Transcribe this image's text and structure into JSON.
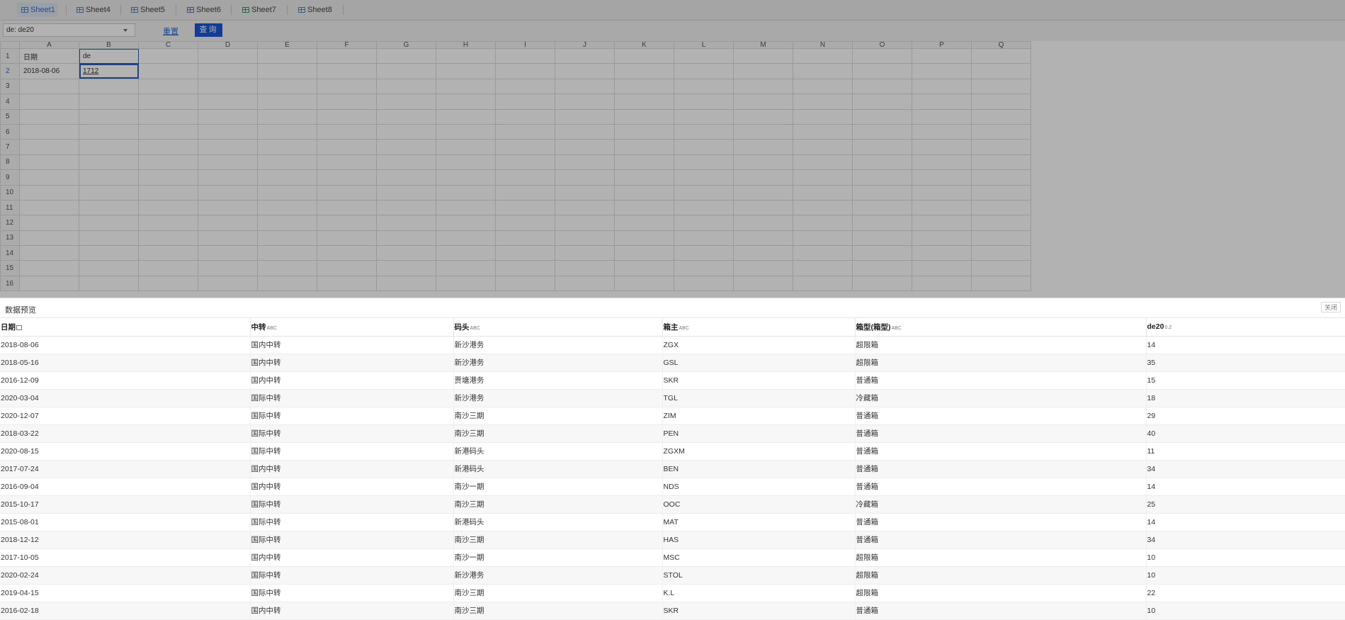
{
  "tabs": [
    {
      "label": "Sheet1",
      "active": true
    },
    {
      "label": "Sheet4",
      "active": false
    },
    {
      "label": "Sheet5",
      "active": false
    },
    {
      "label": "Sheet6",
      "active": false
    },
    {
      "label": "Sheet7",
      "active": false
    },
    {
      "label": "Sheet8",
      "active": false
    }
  ],
  "toolbar": {
    "param_value": "de: de20",
    "reset_label": "重置",
    "query_label": "查询"
  },
  "sheet": {
    "columns": [
      "A",
      "B",
      "C",
      "D",
      "E",
      "F",
      "G",
      "H",
      "I",
      "J",
      "K",
      "L",
      "M",
      "N",
      "O",
      "P",
      "Q"
    ],
    "row_numbers": [
      "1",
      "2",
      "3",
      "4",
      "5",
      "6",
      "7",
      "8",
      "9",
      "10",
      "11",
      "12",
      "13",
      "14",
      "15",
      "16"
    ],
    "selected_column": "B",
    "active_row": "2",
    "cells": {
      "A1": "日期",
      "B1": "de",
      "A2": "2018-08-06",
      "B2": "1712"
    }
  },
  "preview": {
    "title": "数据预览",
    "close_label": "关闭",
    "columns": [
      {
        "label": "日期",
        "type": "date-icon"
      },
      {
        "label": "中转",
        "type": "ABC"
      },
      {
        "label": "码头",
        "type": "ABC"
      },
      {
        "label": "箱主",
        "type": "ABC"
      },
      {
        "label": "箱型(箱型)",
        "type": "ABC"
      },
      {
        "label": "de20",
        "type": "0.2"
      }
    ],
    "rows": [
      [
        "2018-08-06",
        "国内中转",
        "新沙港务",
        "ZGX",
        "超限箱",
        "14"
      ],
      [
        "2018-05-16",
        "国内中转",
        "新沙港务",
        "GSL",
        "超限箱",
        "35"
      ],
      [
        "2016-12-09",
        "国内中转",
        "贾塘港务",
        "SKR",
        "普通箱",
        "15"
      ],
      [
        "2020-03-04",
        "国际中转",
        "新沙港务",
        "TGL",
        "冷藏箱",
        "18"
      ],
      [
        "2020-12-07",
        "国际中转",
        "南沙三期",
        "ZIM",
        "普通箱",
        "29"
      ],
      [
        "2018-03-22",
        "国际中转",
        "南沙三期",
        "PEN",
        "普通箱",
        "40"
      ],
      [
        "2020-08-15",
        "国际中转",
        "新港码头",
        "ZGXM",
        "普通箱",
        "11"
      ],
      [
        "2017-07-24",
        "国内中转",
        "新港码头",
        "BEN",
        "普通箱",
        "34"
      ],
      [
        "2016-09-04",
        "国内中转",
        "南沙一期",
        "NDS",
        "普通箱",
        "14"
      ],
      [
        "2015-10-17",
        "国际中转",
        "南沙三期",
        "OOC",
        "冷藏箱",
        "25"
      ],
      [
        "2015-08-01",
        "国际中转",
        "新港码头",
        "MAT",
        "普通箱",
        "14"
      ],
      [
        "2018-12-12",
        "国际中转",
        "南沙三期",
        "HAS",
        "普通箱",
        "34"
      ],
      [
        "2017-10-05",
        "国内中转",
        "南沙一期",
        "MSC",
        "超限箱",
        "10"
      ],
      [
        "2020-02-24",
        "国际中转",
        "新沙港务",
        "STOL",
        "超限箱",
        "10"
      ],
      [
        "2019-04-15",
        "国际中转",
        "南沙三期",
        "K.L",
        "超限箱",
        "22"
      ],
      [
        "2016-02-18",
        "国内中转",
        "南沙三期",
        "SKR",
        "普通箱",
        "10"
      ]
    ]
  }
}
